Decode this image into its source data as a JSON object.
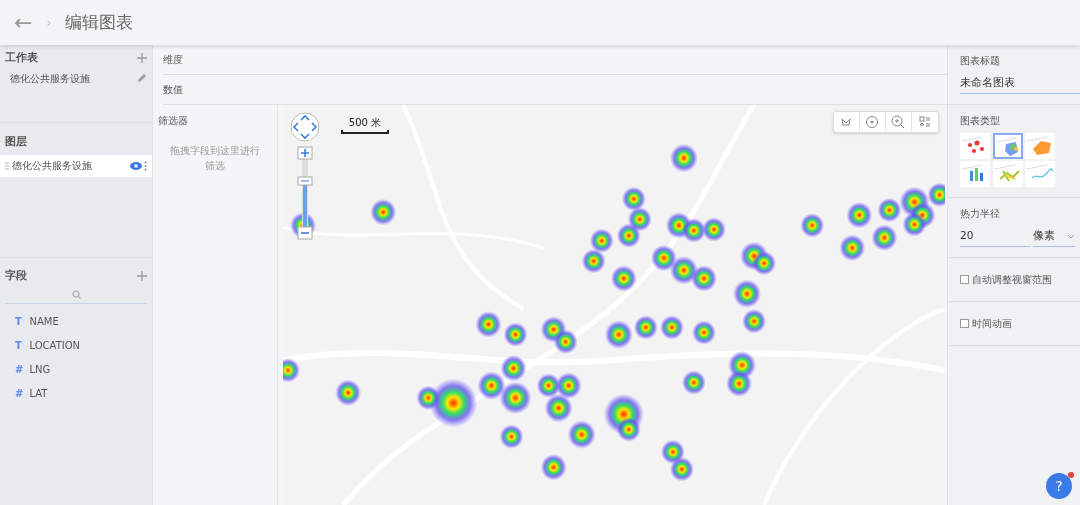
{
  "header": {
    "back_icon": "←",
    "separator": "›",
    "title": "编辑图表"
  },
  "sidebar": {
    "worksheets": {
      "title": "工作表",
      "items": [
        {
          "label": "德化公共服务设施"
        }
      ]
    },
    "layers": {
      "title": "图层",
      "items": [
        {
          "label": "德化公共服务设施",
          "selected": true,
          "visible": true
        }
      ]
    },
    "fields": {
      "title": "字段",
      "items": [
        {
          "kind": "text",
          "type_glyph": "T",
          "label": "NAME"
        },
        {
          "kind": "text",
          "type_glyph": "T",
          "label": "LOCATION"
        },
        {
          "kind": "number",
          "type_glyph": "#",
          "label": "LNG"
        },
        {
          "kind": "number",
          "type_glyph": "#",
          "label": "LAT"
        }
      ]
    }
  },
  "shelves": [
    {
      "label": "维度"
    },
    {
      "label": "数值"
    }
  ],
  "filter": {
    "title": "筛选器",
    "hint": "拖拽字段到这里进行筛选"
  },
  "map": {
    "scale_label": "500 米"
  },
  "settings": {
    "title_label": "图表标题",
    "title_value": "未命名图表",
    "type_label": "图表类型",
    "chart_types": [
      {
        "kind": "points",
        "selected": false
      },
      {
        "kind": "heat",
        "selected": true
      },
      {
        "kind": "dots",
        "selected": false
      },
      {
        "kind": "bars",
        "selected": false
      },
      {
        "kind": "lines",
        "selected": false
      },
      {
        "kind": "curve",
        "selected": false
      }
    ],
    "radius_label": "热力半径",
    "radius_value": "20",
    "radius_unit": "像素",
    "options": [
      {
        "label": "自动调整视窗范围",
        "checked": false
      },
      {
        "label": "时间动画",
        "checked": false
      }
    ]
  },
  "help": {
    "label": "?",
    "has_notification": true
  }
}
